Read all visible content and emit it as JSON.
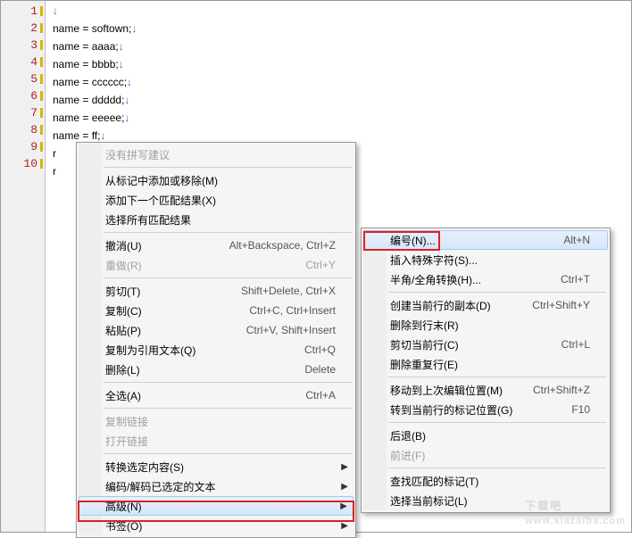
{
  "code_lines": [
    "↓",
    "name = softown;↓",
    "name = aaaa;↓",
    "name = bbbb;↓",
    "name = cccccc;↓",
    "name = ddddd;↓",
    "name = eeeee;↓",
    "name = ff;↓",
    "r",
    "r"
  ],
  "line_numbers": [
    "1",
    "2",
    "3",
    "4",
    "5",
    "6",
    "7",
    "8",
    "9",
    "10"
  ],
  "menu1": {
    "no_suggestions": "没有拼写建议",
    "add_remove_markers": "从标记中添加或移除(M)",
    "add_next_match": "添加下一个匹配结果(X)",
    "select_all_matches": "选择所有匹配结果",
    "undo": {
      "label": "撤消(U)",
      "shortcut": "Alt+Backspace, Ctrl+Z"
    },
    "redo": {
      "label": "重做(R)",
      "shortcut": "Ctrl+Y"
    },
    "cut": {
      "label": "剪切(T)",
      "shortcut": "Shift+Delete, Ctrl+X"
    },
    "copy": {
      "label": "复制(C)",
      "shortcut": "Ctrl+C, Ctrl+Insert"
    },
    "paste": {
      "label": "粘贴(P)",
      "shortcut": "Ctrl+V, Shift+Insert"
    },
    "copy_as_quoted": {
      "label": "复制为引用文本(Q)",
      "shortcut": "Ctrl+Q"
    },
    "delete": {
      "label": "删除(L)",
      "shortcut": "Delete"
    },
    "select_all": {
      "label": "全选(A)",
      "shortcut": "Ctrl+A"
    },
    "copy_link": "复制链接",
    "open_link": "打开链接",
    "convert_selection": "转换选定内容(S)",
    "encode_decode": "编码/解码已选定的文本",
    "advanced": "高级(N)",
    "bookmarks": "书签(O)"
  },
  "menu2": {
    "numbering": {
      "label": "编号(N)...",
      "shortcut": "Alt+N"
    },
    "insert_special": "插入特殊字符(S)...",
    "half_full_width": {
      "label": "半角/全角转换(H)...",
      "shortcut": "Ctrl+T"
    },
    "duplicate_line": {
      "label": "创建当前行的副本(D)",
      "shortcut": "Ctrl+Shift+Y"
    },
    "delete_to_eol": "删除到行末(R)",
    "cut_line": {
      "label": "剪切当前行(C)",
      "shortcut": "Ctrl+L"
    },
    "delete_dup_lines": "删除重复行(E)",
    "move_to_last_edit": {
      "label": "移动到上次编辑位置(M)",
      "shortcut": "Ctrl+Shift+Z"
    },
    "goto_bookmark_pos": {
      "label": "转到当前行的标记位置(G)",
      "shortcut": "F10"
    },
    "back": "后退(B)",
    "forward": "前进(F)",
    "find_matching_bracket": "查找匹配的标记(T)",
    "select_current_bracket": "选择当前标记(L)"
  },
  "watermark": {
    "big": "下载吧",
    "small": "www.xiazaiba.com"
  }
}
